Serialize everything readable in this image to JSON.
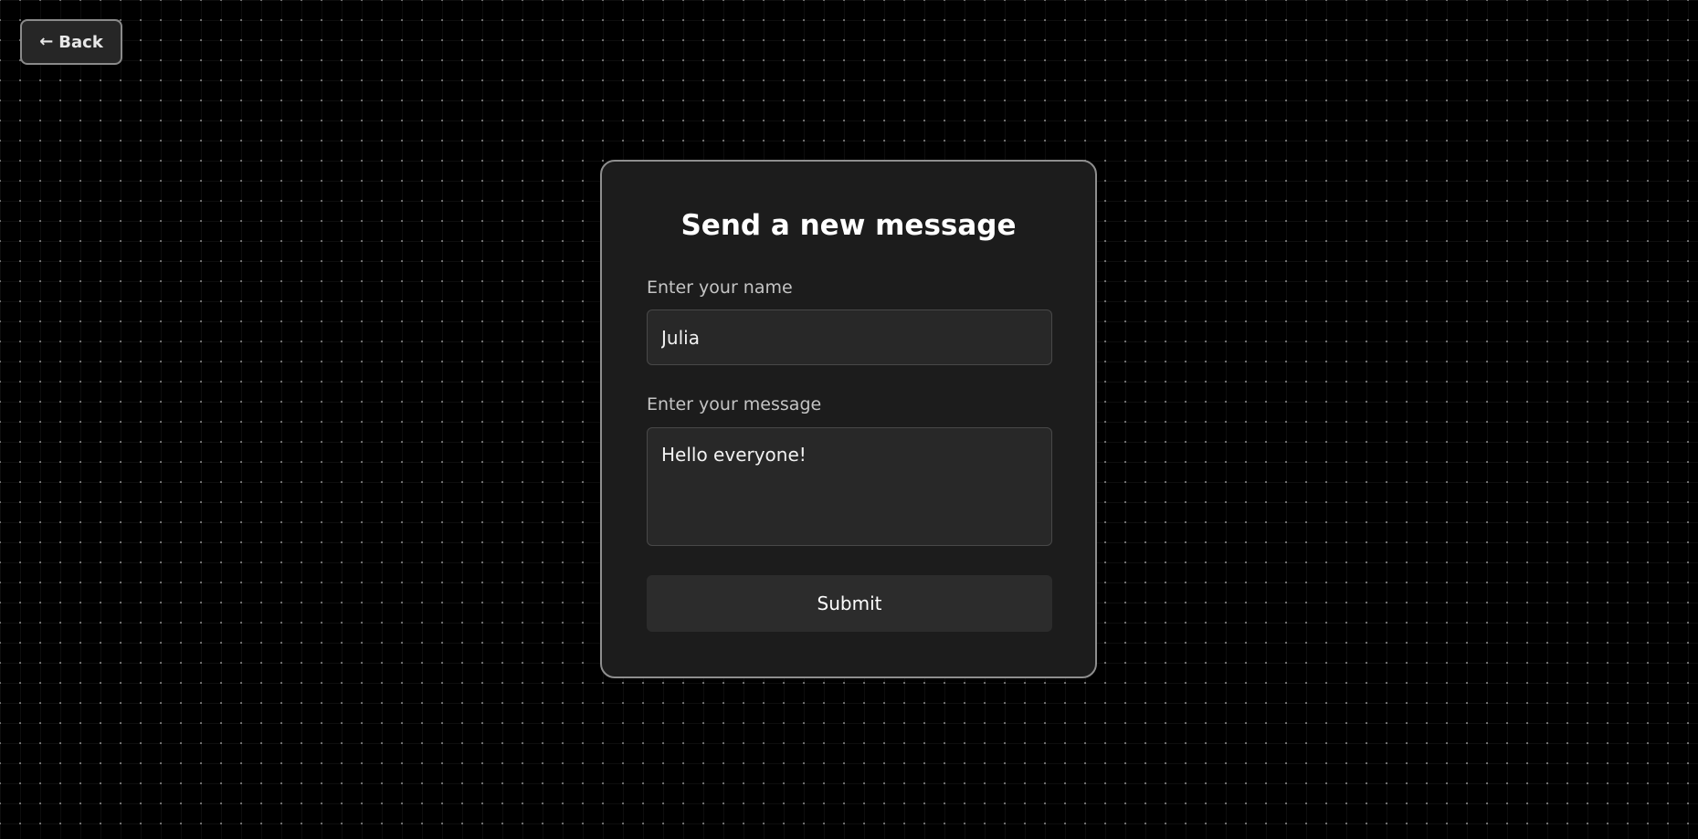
{
  "nav": {
    "back_arrow": "←",
    "back_label": "Back"
  },
  "form": {
    "title": "Send a new message",
    "name_label": "Enter your name",
    "name_value": "Julia",
    "message_label": "Enter your message",
    "message_value": "Hello everyone!",
    "submit_label": "Submit"
  },
  "colors": {
    "background": "#000000",
    "card": "#1c1c1c",
    "card_border": "#8e8e8e",
    "input_background": "#282828",
    "button_background": "#2c2c2c",
    "text_primary": "#ffffff",
    "text_label": "#c4c4c4"
  },
  "icons": {
    "back": "arrow-left-icon"
  }
}
